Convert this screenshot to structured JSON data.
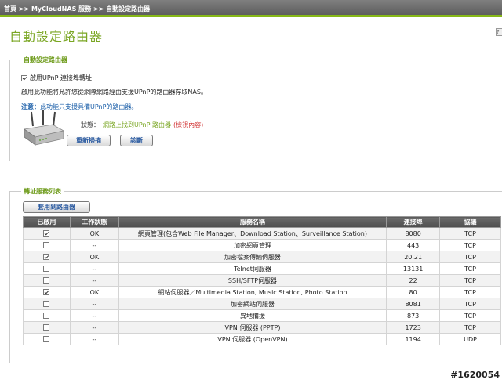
{
  "header": {
    "breadcrumb": "首頁 >> MyCloudNAS 服務 >> 自動設定路由器"
  },
  "page": {
    "title": "自動設定路由器"
  },
  "router_section": {
    "legend": "自動設定路由器",
    "upnp_checkbox_checked": true,
    "upnp_label": "啟用UPnP 連接埠轉址",
    "description": "啟用此功能將允許您從網際網路經由支援UPnP的路由器存取NAS。",
    "note_prefix": "注意：",
    "note_text": "此功能只支援具備UPnP的路由器。",
    "status_label": "狀態：",
    "status_value": "網路上找到UPnP 路由器",
    "status_link": "(檢視內容)",
    "rescan_button": "重新掃描",
    "diagnose_button": "診斷"
  },
  "service_section": {
    "legend": "轉址服務列表",
    "apply_button": "套用到路由器",
    "columns": [
      "已啟用",
      "工作狀態",
      "服務名稱",
      "連接埠",
      "協議"
    ],
    "rows": [
      {
        "enabled": true,
        "status": "OK",
        "name": "網頁管理(包含Web File Manager、Download Station、Surveillance Station)",
        "port": "8080",
        "protocol": "TCP"
      },
      {
        "enabled": false,
        "status": "--",
        "name": "加密網頁管理",
        "port": "443",
        "protocol": "TCP"
      },
      {
        "enabled": true,
        "status": "OK",
        "name": "加密檔案傳輸伺服器",
        "port": "20,21",
        "protocol": "TCP"
      },
      {
        "enabled": false,
        "status": "--",
        "name": "Telnet伺服器",
        "port": "13131",
        "protocol": "TCP"
      },
      {
        "enabled": false,
        "status": "--",
        "name": "SSH/SFTP伺服器",
        "port": "22",
        "protocol": "TCP"
      },
      {
        "enabled": true,
        "status": "OK",
        "name": "網站伺服器／Multimedia Station, Music Station, Photo Station",
        "port": "80",
        "protocol": "TCP"
      },
      {
        "enabled": false,
        "status": "--",
        "name": "加密網站伺服器",
        "port": "8081",
        "protocol": "TCP"
      },
      {
        "enabled": false,
        "status": "--",
        "name": "異地備援",
        "port": "873",
        "protocol": "TCP"
      },
      {
        "enabled": false,
        "status": "--",
        "name": "VPN 伺服器 (PPTP)",
        "port": "1723",
        "protocol": "TCP"
      },
      {
        "enabled": false,
        "status": "--",
        "name": "VPN 伺服器 (OpenVPN)",
        "port": "1194",
        "protocol": "UDP"
      }
    ]
  },
  "watermark": "#1620054",
  "colors": {
    "accent_green": "#7aa623",
    "topbar_gray": "#6b6b6b",
    "link_red": "#d03030"
  }
}
